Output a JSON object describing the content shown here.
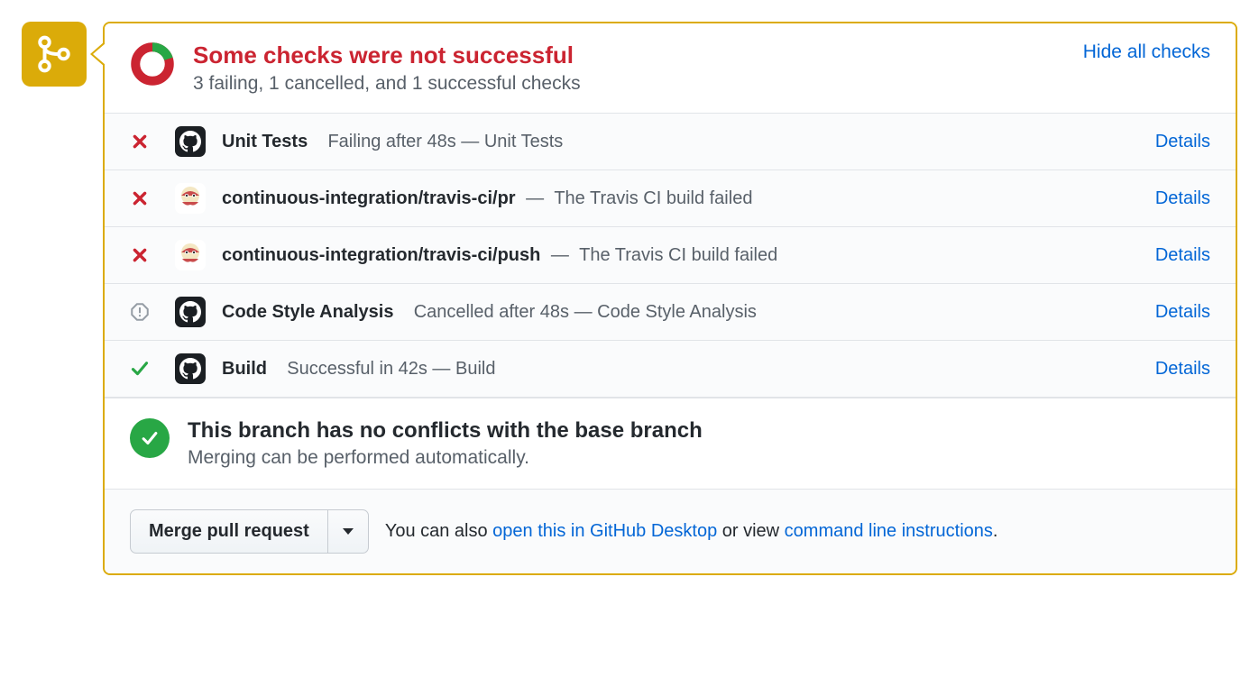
{
  "summary": {
    "title": "Some checks were not successful",
    "subtitle": "3 failing, 1 cancelled, and 1 successful checks",
    "hide_link": "Hide all checks"
  },
  "checks": [
    {
      "status": "fail",
      "avatar": "github",
      "name": "Unit Tests",
      "sep_space": true,
      "desc": "Failing after 48s — Unit Tests",
      "details": "Details"
    },
    {
      "status": "fail",
      "avatar": "travis",
      "name": "continuous-integration/travis-ci/pr",
      "sep_space": false,
      "desc": "The Travis CI build failed",
      "details": "Details"
    },
    {
      "status": "fail",
      "avatar": "travis",
      "name": "continuous-integration/travis-ci/push",
      "sep_space": false,
      "desc": "The Travis CI build failed",
      "details": "Details"
    },
    {
      "status": "cancelled",
      "avatar": "github",
      "name": "Code Style Analysis",
      "sep_space": true,
      "desc": "Cancelled after 48s — Code Style Analysis",
      "details": "Details"
    },
    {
      "status": "success",
      "avatar": "github",
      "name": "Build",
      "sep_space": true,
      "desc": "Successful in 42s — Build",
      "details": "Details"
    }
  ],
  "conflicts": {
    "title": "This branch has no conflicts with the base branch",
    "subtitle": "Merging can be performed automatically."
  },
  "merge": {
    "button": "Merge pull request",
    "text_pre": "You can also ",
    "link1": "open this in GitHub Desktop",
    "text_mid": " or view ",
    "link2": "command line instructions",
    "text_post": "."
  }
}
